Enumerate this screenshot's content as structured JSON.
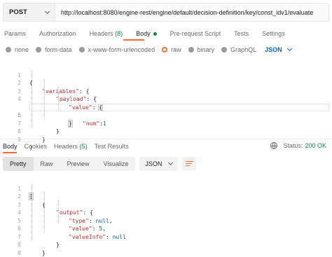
{
  "request": {
    "method": "POST",
    "url": "http://localhost:8080/engine-rest/engine/default/decision-definition/key/const_idv1/evaluate"
  },
  "request_tabs": [
    {
      "label": "Params"
    },
    {
      "label": "Authorization"
    },
    {
      "label": "Headers",
      "count": "(8)"
    },
    {
      "label": "Body"
    },
    {
      "label": "Pre-request Script"
    },
    {
      "label": "Tests"
    },
    {
      "label": "Settings"
    }
  ],
  "body_types": [
    {
      "label": "none"
    },
    {
      "label": "form-data"
    },
    {
      "label": "x-www-form-urlencoded"
    },
    {
      "label": "raw"
    },
    {
      "label": "binary"
    },
    {
      "label": "GraphQL"
    }
  ],
  "body_language": "JSON",
  "request_body_lines": [
    "1",
    "2",
    "3",
    "4",
    "5",
    "6",
    "7",
    "8",
    "9"
  ],
  "request_body_tokens": {
    "open": "{",
    "variables_key": "\"variables\"",
    "payload_key": "\"payload\"",
    "value_key": "\"value\"",
    "num_key": "\"num\"",
    "num_val": "1",
    "colon": ": ",
    "colon_tight": ":",
    "close": "}"
  },
  "response_tabs": [
    {
      "label": "Body"
    },
    {
      "label": "Cookies"
    },
    {
      "label": "Headers",
      "count": "(5)"
    },
    {
      "label": "Test Results"
    }
  ],
  "status": {
    "label": "Status:",
    "code": "200 OK"
  },
  "view_modes": [
    "Pretty",
    "Raw",
    "Preview",
    "Visualize"
  ],
  "response_format": "JSON",
  "response_body_lines": [
    "1",
    "2",
    "3",
    "4",
    "5",
    "6",
    "7",
    "8",
    "9"
  ],
  "response_body_tokens": {
    "open_bracket": "[",
    "close_bracket": "]",
    "open_brace": "{",
    "close_brace": "}",
    "output_key": "\"output\"",
    "type_key": "\"type\"",
    "value_key": "\"value\"",
    "valueinfo_key": "\"valueInfo\"",
    "null": "null",
    "five": "5",
    "colon": ": ",
    "comma": ","
  },
  "colors": {
    "accent": "#ff6c37",
    "success": "#0f8a40",
    "link": "#0265d2"
  }
}
